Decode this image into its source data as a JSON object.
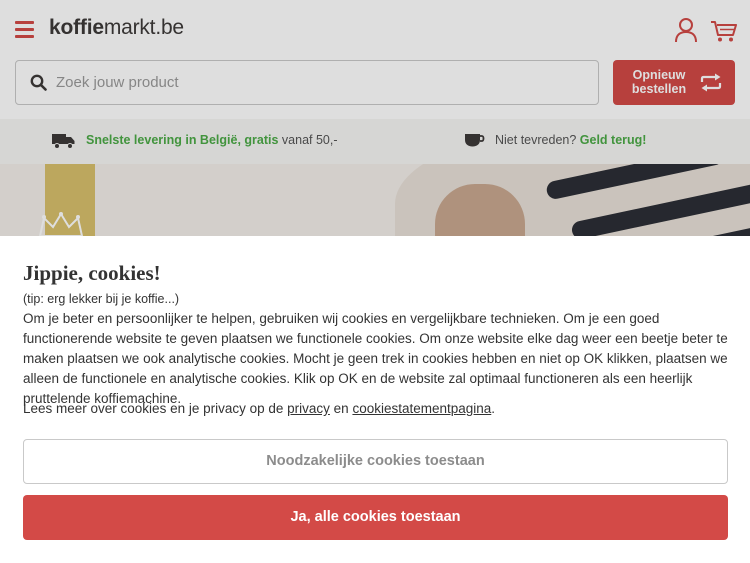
{
  "header": {
    "logo_bold": "koffie",
    "logo_rest": "markt.be"
  },
  "search": {
    "placeholder": "Zoek jouw product"
  },
  "reorder_button": {
    "label": "Opnieuw bestellen"
  },
  "usp": {
    "delivery_highlight": "Snelste levering in België, gratis",
    "delivery_rest": " vanaf 50,-",
    "guarantee_text": "Niet tevreden? ",
    "guarantee_highlight": "Geld terug!"
  },
  "cookie_modal": {
    "title": "Jippie, cookies!",
    "tip": "(tip: erg lekker bij je koffie...)",
    "body": "Om je beter en persoonlijker te helpen, gebruiken wij cookies en vergelijkbare technieken. Om je een goed functionerende website te geven plaatsen we functionele cookies. Om onze website elke dag weer een beetje beter te maken plaatsen we ook analytische cookies. Mocht je geen trek in cookies hebben en niet op OK klikken, plaatsen we alleen de functionele en analytische cookies. Klik op OK en de website zal optimaal functioneren als een heerlijk pruttelende koffiemachine.",
    "more_prefix": "Lees meer over cookies en je privacy op de ",
    "privacy_link": "privacy",
    "more_middle": " en ",
    "cookie_link": "cookiestatementpagina",
    "more_suffix": ".",
    "necessary_button": "Noodzakelijke cookies toestaan",
    "accept_all_button": "Ja, alle cookies toestaan"
  },
  "colors": {
    "brand_red": "#d34a47",
    "usp_green": "#4caa47"
  }
}
